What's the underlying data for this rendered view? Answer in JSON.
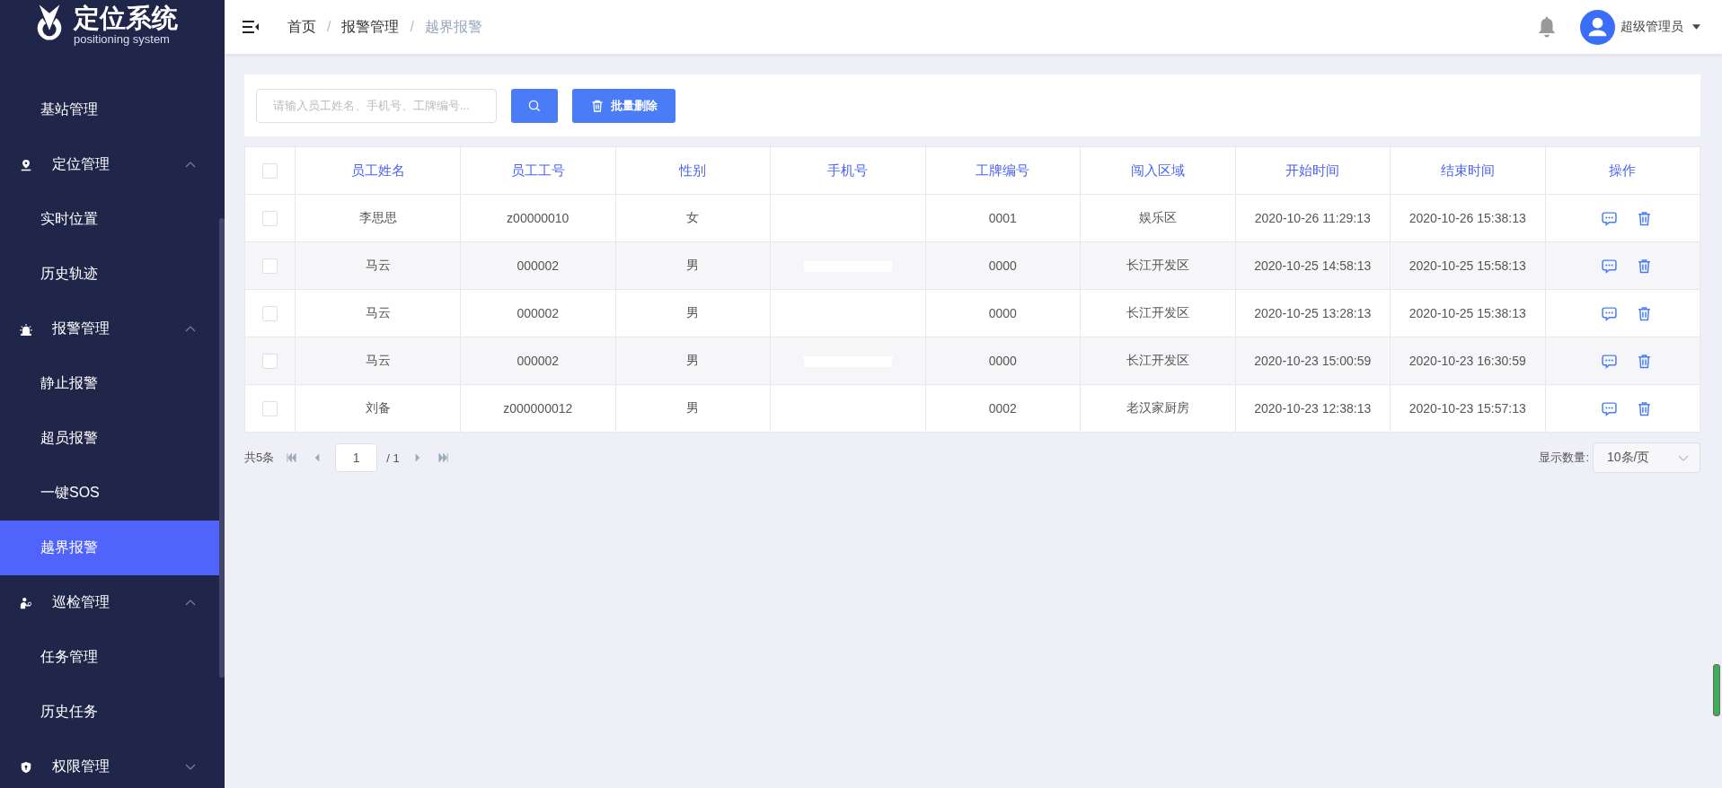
{
  "logo": {
    "title": "定位系统",
    "subtitle": "positioning system"
  },
  "sidebar": {
    "items": [
      {
        "kind": "link",
        "label": "基站管理",
        "selected": false
      },
      {
        "kind": "group",
        "label": "定位管理",
        "expanded": true,
        "children": [
          {
            "kind": "link",
            "label": "实时位置",
            "selected": false
          },
          {
            "kind": "link",
            "label": "历史轨迹",
            "selected": false
          }
        ]
      },
      {
        "kind": "group",
        "label": "报警管理",
        "expanded": true,
        "children": [
          {
            "kind": "link",
            "label": "静止报警",
            "selected": false
          },
          {
            "kind": "link",
            "label": "超员报警",
            "selected": false
          },
          {
            "kind": "link",
            "label": "一键SOS",
            "selected": false
          },
          {
            "kind": "link",
            "label": "越界报警",
            "selected": true
          }
        ]
      },
      {
        "kind": "group",
        "label": "巡检管理",
        "expanded": true,
        "children": [
          {
            "kind": "link",
            "label": "任务管理",
            "selected": false
          },
          {
            "kind": "link",
            "label": "历史任务",
            "selected": false
          }
        ]
      },
      {
        "kind": "group",
        "label": "权限管理",
        "expanded": false
      }
    ]
  },
  "breadcrumb": {
    "items": [
      "首页",
      "报警管理",
      "越界报警"
    ],
    "separator": "/"
  },
  "user": {
    "name": "超级管理员"
  },
  "search": {
    "placeholder": "请输入员工姓名、手机号、工牌编号..."
  },
  "batch_delete": {
    "label": "批量删除"
  },
  "table": {
    "all_checked": false,
    "columns": [
      "员工姓名",
      "员工工号",
      "性别",
      "手机号",
      "工牌编号",
      "闯入区域",
      "开始时间",
      "结束时间",
      "操作"
    ],
    "rows": [
      {
        "checked": false,
        "cells": [
          "李思思",
          "z00000010",
          "女",
          "",
          "0001",
          "娱乐区",
          "2020-10-26 11:29:13",
          "2020-10-26 15:38:13"
        ],
        "phone_masked": false
      },
      {
        "checked": false,
        "cells": [
          "马云",
          "000002",
          "男",
          "",
          "0000",
          "长江开发区",
          "2020-10-25 14:58:13",
          "2020-10-25 15:58:13"
        ],
        "phone_masked": true
      },
      {
        "checked": false,
        "cells": [
          "马云",
          "000002",
          "男",
          "",
          "0000",
          "长江开发区",
          "2020-10-25 13:28:13",
          "2020-10-25 15:38:13"
        ],
        "phone_masked": false
      },
      {
        "checked": false,
        "cells": [
          "马云",
          "000002",
          "男",
          "",
          "0000",
          "长江开发区",
          "2020-10-23 15:00:59",
          "2020-10-23 16:30:59"
        ],
        "phone_masked": true
      },
      {
        "checked": false,
        "cells": [
          "刘备",
          "z000000012",
          "男",
          "",
          "0002",
          "老汉家厨房",
          "2020-10-23 12:38:13",
          "2020-10-23 15:57:13"
        ],
        "phone_masked": false
      }
    ]
  },
  "pagination": {
    "total": "共5条",
    "page": "1",
    "pages": "/ 1",
    "page_size_label": "显示数量:",
    "page_size": "10条/页"
  }
}
